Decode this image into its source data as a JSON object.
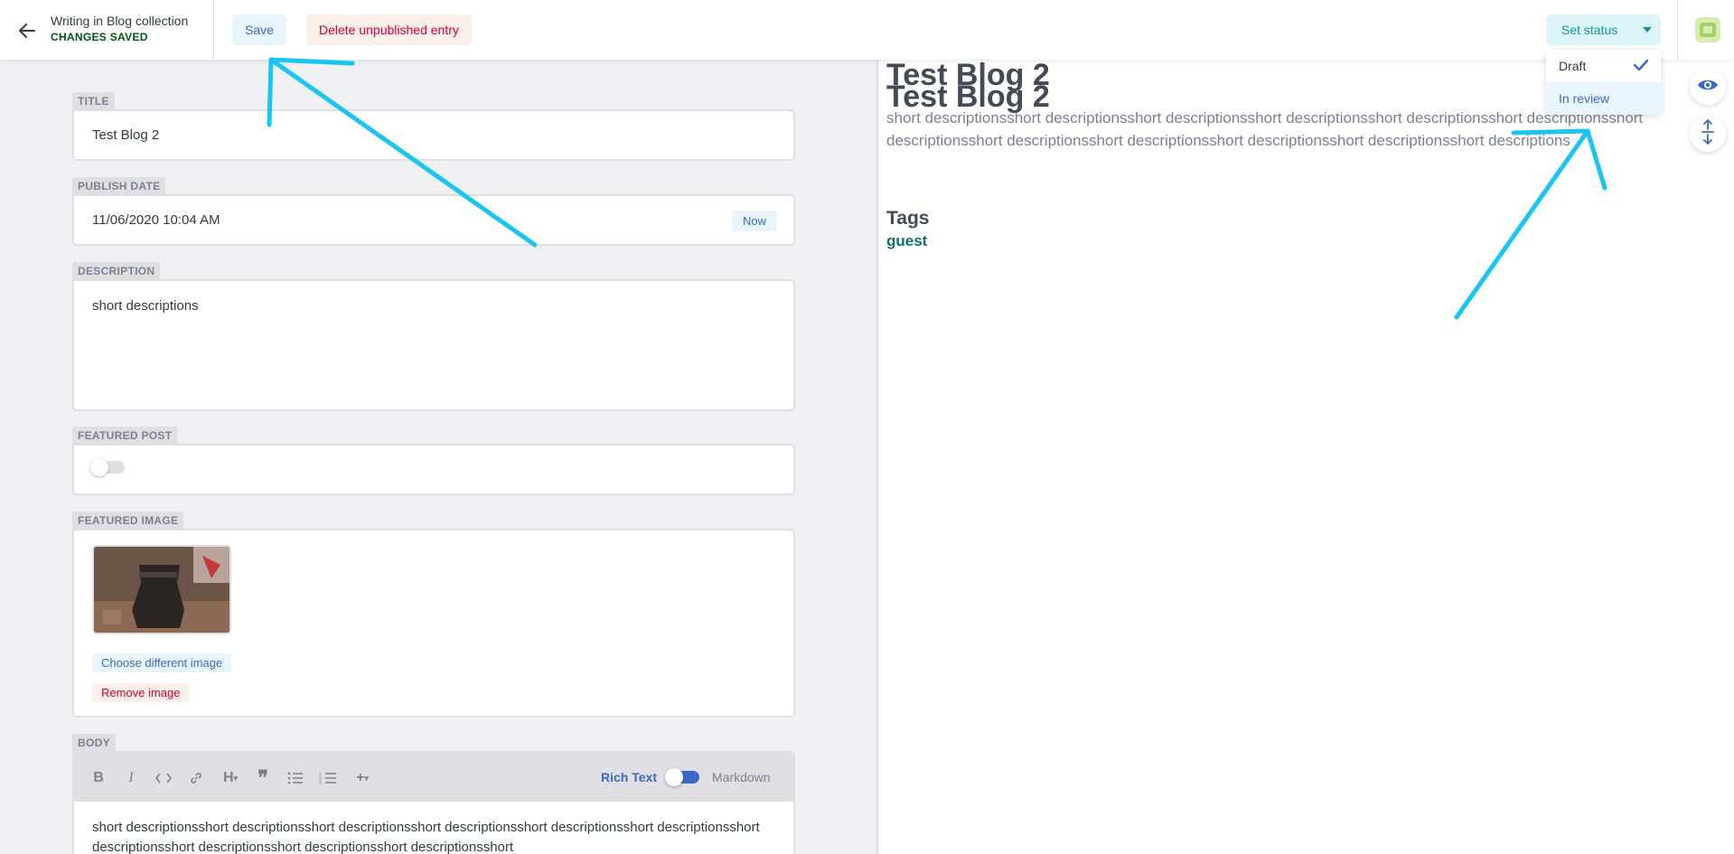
{
  "header": {
    "collection_title": "Writing in Blog collection",
    "save_status": "CHANGES SAVED",
    "save_label": "Save",
    "delete_label": "Delete unpublished entry",
    "set_status_label": "Set status"
  },
  "status_dropdown": {
    "items": [
      {
        "label": "Draft",
        "checked": true
      },
      {
        "label": "In review",
        "checked": false
      }
    ]
  },
  "fields": {
    "title": {
      "label": "TITLE",
      "value": "Test Blog 2"
    },
    "publish_date": {
      "label": "PUBLISH DATE",
      "value": "11/06/2020 10:04 AM",
      "now_label": "Now"
    },
    "description": {
      "label": "DESCRIPTION",
      "value": "short descriptions"
    },
    "featured_post": {
      "label": "FEATURED POST",
      "value": false
    },
    "featured_image": {
      "label": "FEATURED IMAGE",
      "choose_label": "Choose different image",
      "remove_label": "Remove image"
    },
    "body": {
      "label": "BODY",
      "mode_rich": "Rich Text",
      "mode_markdown": "Markdown",
      "text": "short descriptionsshort descriptionsshort descriptionsshort descriptionsshort descriptionsshort descriptionsshort descriptionsshort descriptionsshort descriptionsshort descriptionsshort"
    }
  },
  "preview": {
    "title_1": "Test Blog 2",
    "title_2": "Test Blog 2",
    "description": "short descriptionsshort descriptionsshort descriptionsshort descriptionsshort descriptionsshort descriptionsshort descriptionsshort descriptionsshort descriptionsshort descriptionsshort descriptionsshort descriptions",
    "tags_heading": "Tags",
    "tag": "guest"
  },
  "colors": {
    "accent_blue": "#3a69c7",
    "danger_red": "#d60032",
    "status_teal": "#1195aa",
    "saved_green": "#005614",
    "annotation_cyan": "#1ac6f0"
  }
}
